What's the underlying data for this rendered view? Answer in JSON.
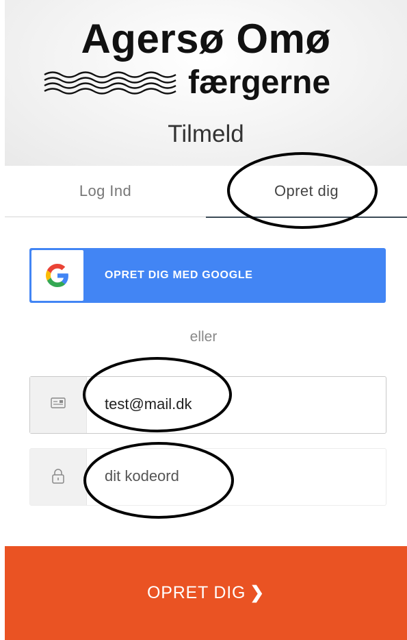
{
  "header": {
    "logo_line1": "Agersø Omø",
    "logo_line2": "færgerne",
    "subtitle": "Tilmeld"
  },
  "tabs": [
    {
      "label": "Log Ind",
      "active": false
    },
    {
      "label": "Opret dig",
      "active": true
    }
  ],
  "google_button": {
    "label": "OPRET DIG MED GOOGLE",
    "icon": "google-icon"
  },
  "divider_text": "eller",
  "email_field": {
    "value": "test@mail.dk",
    "icon": "id-card-icon"
  },
  "password_field": {
    "placeholder": "dit kodeord",
    "icon": "lock-icon"
  },
  "submit_button": {
    "label": "OPRET DIG",
    "chevron": "❯"
  },
  "colors": {
    "google_blue": "#4285f4",
    "submit_orange": "#ea5323",
    "active_tab_underline": "#3b4a56"
  }
}
